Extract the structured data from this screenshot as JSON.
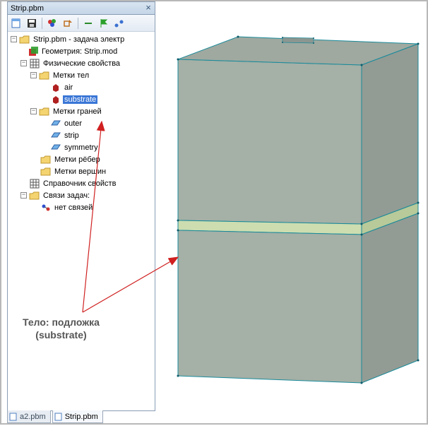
{
  "panel": {
    "title": "Strip.pbm",
    "toolbar": {
      "btn1": "new-file",
      "btn2": "save-file",
      "btn3": "color-balls",
      "btn4": "rotate-shape",
      "btn5": "minus",
      "btn6": "green-flag",
      "btn7": "blue-dots"
    },
    "tree": {
      "root": "Strip.pbm - задача электр",
      "geometry": "Геометрия: Strip.mod",
      "physprops": "Физические свойства",
      "bodylabels": "Метки тел",
      "air": "air",
      "substrate": "substrate",
      "facelabels": "Метки граней",
      "outer": "outer",
      "strip": "strip",
      "symmetry": "symmetry",
      "edgelabels": "Метки рёбер",
      "vertexlabels": "Метки вершин",
      "propref": "Справочник свойств",
      "tasklinks": "Связи задач:",
      "nolinks": "нет связей"
    }
  },
  "footer": {
    "tab1": "a2.pbm",
    "tab2": "Strip.pbm"
  },
  "annotation": {
    "line1": "Тело: подложка",
    "line2": "(substrate)"
  }
}
